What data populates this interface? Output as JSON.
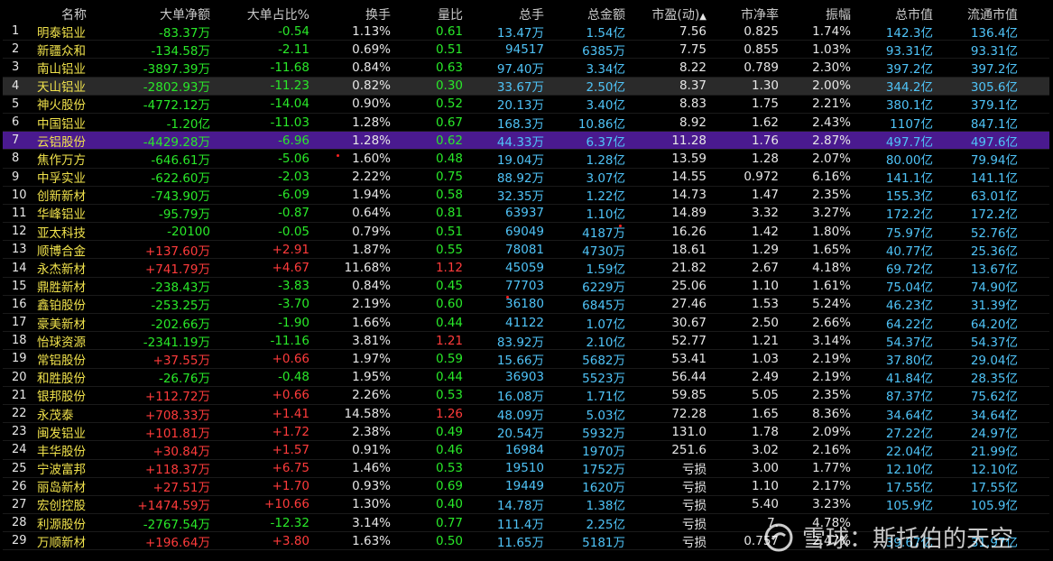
{
  "headers": [
    "名称",
    "大单净额",
    "大单占比%",
    "换手",
    "量比",
    "总手",
    "总金额",
    "市盈(动)",
    "市净率",
    "振幅",
    "总市值",
    "流通市值"
  ],
  "sort_icon": "up-arrow-icon",
  "rows": [
    {
      "idx": "1",
      "name": "明泰铝业",
      "net": "-83.37万",
      "net_c": "g",
      "pct": "-0.54",
      "pct_c": "g",
      "turn": "1.13%",
      "vr": "0.61",
      "vr_c": "g",
      "vol": "13.47万",
      "amt": "1.54亿",
      "pe": "7.56",
      "pb": "0.825",
      "amp": "1.74%",
      "mcap": "142.3亿",
      "fcap": "136.4亿"
    },
    {
      "idx": "2",
      "name": "新疆众和",
      "net": "-134.58万",
      "net_c": "g",
      "pct": "-2.11",
      "pct_c": "g",
      "turn": "0.69%",
      "vr": "0.51",
      "vr_c": "g",
      "vol": "94517",
      "amt": "6385万",
      "pe": "7.75",
      "pb": "0.855",
      "amp": "1.03%",
      "mcap": "93.31亿",
      "fcap": "93.31亿"
    },
    {
      "idx": "3",
      "name": "南山铝业",
      "net": "-3897.39万",
      "net_c": "g",
      "pct": "-11.68",
      "pct_c": "g",
      "turn": "0.84%",
      "vr": "0.63",
      "vr_c": "g",
      "vol": "97.40万",
      "amt": "3.34亿",
      "pe": "8.22",
      "pb": "0.789",
      "amp": "2.30%",
      "mcap": "397.2亿",
      "fcap": "397.2亿"
    },
    {
      "idx": "4",
      "name": "天山铝业",
      "net": "-2802.93万",
      "net_c": "g",
      "pct": "-11.23",
      "pct_c": "g",
      "turn": "0.82%",
      "vr": "0.30",
      "vr_c": "g",
      "vol": "33.67万",
      "amt": "2.50亿",
      "pe": "8.37",
      "pb": "1.30",
      "amp": "2.00%",
      "mcap": "344.2亿",
      "fcap": "305.6亿",
      "hl": "hl-dark"
    },
    {
      "idx": "5",
      "name": "神火股份",
      "net": "-4772.12万",
      "net_c": "g",
      "pct": "-14.04",
      "pct_c": "g",
      "turn": "0.90%",
      "vr": "0.52",
      "vr_c": "g",
      "vol": "20.13万",
      "amt": "3.40亿",
      "pe": "8.83",
      "pb": "1.75",
      "amp": "2.21%",
      "mcap": "380.1亿",
      "fcap": "379.1亿"
    },
    {
      "idx": "6",
      "name": "中国铝业",
      "net": "-1.20亿",
      "net_c": "g",
      "pct": "-11.03",
      "pct_c": "g",
      "turn": "1.28%",
      "vr": "0.67",
      "vr_c": "g",
      "vol": "168.3万",
      "amt": "10.86亿",
      "pe": "8.92",
      "pb": "1.62",
      "amp": "2.43%",
      "mcap": "1107亿",
      "fcap": "847.1亿"
    },
    {
      "idx": "7",
      "name": "云铝股份",
      "net": "-4429.28万",
      "net_c": "g",
      "pct": "-6.96",
      "pct_c": "g",
      "turn": "1.28%",
      "vr": "0.62",
      "vr_c": "g",
      "vol": "44.33万",
      "amt": "6.37亿",
      "pe": "11.28",
      "pb": "1.76",
      "amp": "2.87%",
      "mcap": "497.7亿",
      "fcap": "497.6亿",
      "hl": "hl-purple"
    },
    {
      "idx": "8",
      "name": "焦作万方",
      "net": "-646.61万",
      "net_c": "g",
      "pct": "-5.06",
      "pct_c": "g",
      "turn": "1.60%",
      "vr": "0.48",
      "vr_c": "g",
      "vol": "19.04万",
      "amt": "1.28亿",
      "pe": "13.59",
      "pb": "1.28",
      "amp": "2.07%",
      "mcap": "80.00亿",
      "fcap": "79.94亿"
    },
    {
      "idx": "9",
      "name": "中孚实业",
      "net": "-622.60万",
      "net_c": "g",
      "pct": "-2.03",
      "pct_c": "g",
      "turn": "2.22%",
      "vr": "0.75",
      "vr_c": "g",
      "vol": "88.92万",
      "amt": "3.07亿",
      "pe": "14.55",
      "pb": "0.972",
      "amp": "6.16%",
      "mcap": "141.1亿",
      "fcap": "141.1亿"
    },
    {
      "idx": "10",
      "name": "创新新材",
      "net": "-743.90万",
      "net_c": "g",
      "pct": "-6.09",
      "pct_c": "g",
      "turn": "1.94%",
      "vr": "0.58",
      "vr_c": "g",
      "vol": "32.35万",
      "amt": "1.22亿",
      "pe": "14.73",
      "pb": "1.47",
      "amp": "2.35%",
      "mcap": "155.3亿",
      "fcap": "63.01亿"
    },
    {
      "idx": "11",
      "name": "华峰铝业",
      "net": "-95.79万",
      "net_c": "g",
      "pct": "-0.87",
      "pct_c": "g",
      "turn": "0.64%",
      "vr": "0.81",
      "vr_c": "g",
      "vol": "63937",
      "amt": "1.10亿",
      "pe": "14.89",
      "pb": "3.32",
      "amp": "3.27%",
      "mcap": "172.2亿",
      "fcap": "172.2亿"
    },
    {
      "idx": "12",
      "name": "亚太科技",
      "net": "-20100",
      "net_c": "g",
      "pct": "-0.05",
      "pct_c": "g",
      "turn": "0.79%",
      "vr": "0.51",
      "vr_c": "g",
      "vol": "69049",
      "amt": "4187万",
      "pe": "16.26",
      "pb": "1.42",
      "amp": "1.80%",
      "mcap": "75.97亿",
      "fcap": "52.76亿"
    },
    {
      "idx": "13",
      "name": "顺博合金",
      "net": "+137.60万",
      "net_c": "r",
      "pct": "+2.91",
      "pct_c": "r",
      "turn": "1.87%",
      "vr": "0.55",
      "vr_c": "g",
      "vol": "78081",
      "amt": "4730万",
      "pe": "18.61",
      "pb": "1.29",
      "amp": "1.65%",
      "mcap": "40.77亿",
      "fcap": "25.36亿"
    },
    {
      "idx": "14",
      "name": "永杰新材",
      "net": "+741.79万",
      "net_c": "r",
      "pct": "+4.67",
      "pct_c": "r",
      "turn": "11.68%",
      "vr": "1.12",
      "vr_c": "r",
      "vol": "45059",
      "amt": "1.59亿",
      "pe": "21.82",
      "pb": "2.67",
      "amp": "4.18%",
      "mcap": "69.72亿",
      "fcap": "13.67亿"
    },
    {
      "idx": "15",
      "name": "鼎胜新材",
      "net": "-238.43万",
      "net_c": "g",
      "pct": "-3.83",
      "pct_c": "g",
      "turn": "0.84%",
      "vr": "0.45",
      "vr_c": "g",
      "vol": "77703",
      "amt": "6229万",
      "pe": "25.06",
      "pb": "1.10",
      "amp": "1.61%",
      "mcap": "75.04亿",
      "fcap": "74.90亿"
    },
    {
      "idx": "16",
      "name": "鑫铂股份",
      "net": "-253.25万",
      "net_c": "g",
      "pct": "-3.70",
      "pct_c": "g",
      "turn": "2.19%",
      "vr": "0.60",
      "vr_c": "g",
      "vol": "36180",
      "amt": "6845万",
      "pe": "27.46",
      "pb": "1.53",
      "amp": "5.24%",
      "mcap": "46.23亿",
      "fcap": "31.39亿"
    },
    {
      "idx": "17",
      "name": "豪美新材",
      "net": "-202.66万",
      "net_c": "g",
      "pct": "-1.90",
      "pct_c": "g",
      "turn": "1.66%",
      "vr": "0.44",
      "vr_c": "g",
      "vol": "41122",
      "amt": "1.07亿",
      "pe": "30.67",
      "pb": "2.50",
      "amp": "2.66%",
      "mcap": "64.22亿",
      "fcap": "64.20亿"
    },
    {
      "idx": "18",
      "name": "怡球资源",
      "net": "-2341.19万",
      "net_c": "g",
      "pct": "-11.16",
      "pct_c": "g",
      "turn": "3.81%",
      "vr": "1.21",
      "vr_c": "r",
      "vol": "83.92万",
      "amt": "2.10亿",
      "pe": "52.77",
      "pb": "1.21",
      "amp": "3.14%",
      "mcap": "54.37亿",
      "fcap": "54.37亿"
    },
    {
      "idx": "19",
      "name": "常铝股份",
      "net": "+37.55万",
      "net_c": "r",
      "pct": "+0.66",
      "pct_c": "r",
      "turn": "1.97%",
      "vr": "0.59",
      "vr_c": "g",
      "vol": "15.66万",
      "amt": "5682万",
      "pe": "53.41",
      "pb": "1.03",
      "amp": "2.19%",
      "mcap": "37.80亿",
      "fcap": "29.04亿"
    },
    {
      "idx": "20",
      "name": "和胜股份",
      "net": "-26.76万",
      "net_c": "g",
      "pct": "-0.48",
      "pct_c": "g",
      "turn": "1.95%",
      "vr": "0.44",
      "vr_c": "g",
      "vol": "36903",
      "amt": "5523万",
      "pe": "56.44",
      "pb": "2.49",
      "amp": "2.19%",
      "mcap": "41.84亿",
      "fcap": "28.35亿"
    },
    {
      "idx": "21",
      "name": "银邦股份",
      "net": "+112.72万",
      "net_c": "r",
      "pct": "+0.66",
      "pct_c": "r",
      "turn": "2.26%",
      "vr": "0.53",
      "vr_c": "g",
      "vol": "16.08万",
      "amt": "1.71亿",
      "pe": "59.85",
      "pb": "5.05",
      "amp": "2.35%",
      "mcap": "87.37亿",
      "fcap": "75.62亿"
    },
    {
      "idx": "22",
      "name": "永茂泰",
      "net": "+708.33万",
      "net_c": "r",
      "pct": "+1.41",
      "pct_c": "r",
      "turn": "14.58%",
      "vr": "1.26",
      "vr_c": "r",
      "vol": "48.09万",
      "amt": "5.03亿",
      "pe": "72.28",
      "pb": "1.65",
      "amp": "8.36%",
      "mcap": "34.64亿",
      "fcap": "34.64亿"
    },
    {
      "idx": "23",
      "name": "闽发铝业",
      "net": "+101.81万",
      "net_c": "r",
      "pct": "+1.72",
      "pct_c": "r",
      "turn": "2.38%",
      "vr": "0.49",
      "vr_c": "g",
      "vol": "20.54万",
      "amt": "5932万",
      "pe": "131.0",
      "pb": "1.78",
      "amp": "2.09%",
      "mcap": "27.22亿",
      "fcap": "24.97亿"
    },
    {
      "idx": "24",
      "name": "丰华股份",
      "net": "+30.84万",
      "net_c": "r",
      "pct": "+1.57",
      "pct_c": "r",
      "turn": "0.91%",
      "vr": "0.46",
      "vr_c": "g",
      "vol": "16984",
      "amt": "1970万",
      "pe": "251.6",
      "pb": "3.02",
      "amp": "2.16%",
      "mcap": "22.04亿",
      "fcap": "21.99亿"
    },
    {
      "idx": "25",
      "name": "宁波富邦",
      "net": "+118.37万",
      "net_c": "r",
      "pct": "+6.75",
      "pct_c": "r",
      "turn": "1.46%",
      "vr": "0.53",
      "vr_c": "g",
      "vol": "19510",
      "amt": "1752万",
      "pe": "亏损",
      "pb": "3.00",
      "amp": "1.77%",
      "mcap": "12.10亿",
      "fcap": "12.10亿"
    },
    {
      "idx": "26",
      "name": "丽岛新材",
      "net": "+27.51万",
      "net_c": "r",
      "pct": "+1.70",
      "pct_c": "r",
      "turn": "0.93%",
      "vr": "0.69",
      "vr_c": "g",
      "vol": "19449",
      "amt": "1620万",
      "pe": "亏损",
      "pb": "1.10",
      "amp": "2.17%",
      "mcap": "17.55亿",
      "fcap": "17.55亿"
    },
    {
      "idx": "27",
      "name": "宏创控股",
      "net": "+1474.59万",
      "net_c": "r",
      "pct": "+10.66",
      "pct_c": "r",
      "turn": "1.30%",
      "vr": "0.40",
      "vr_c": "g",
      "vol": "14.78万",
      "amt": "1.38亿",
      "pe": "亏损",
      "pb": "5.40",
      "amp": "3.23%",
      "mcap": "105.9亿",
      "fcap": "105.9亿"
    },
    {
      "idx": "28",
      "name": "利源股份",
      "net": "-2767.54万",
      "net_c": "g",
      "pct": "-12.32",
      "pct_c": "g",
      "turn": "3.14%",
      "vr": "0.77",
      "vr_c": "g",
      "vol": "111.4万",
      "amt": "2.25亿",
      "pe": "亏损",
      "pb": "7.",
      "amp": "4.78%",
      "mcap": "",
      "fcap": ""
    },
    {
      "idx": "29",
      "name": "万顺新材",
      "net": "+196.64万",
      "net_c": "r",
      "pct": "+3.80",
      "pct_c": "r",
      "turn": "1.63%",
      "vr": "0.50",
      "vr_c": "g",
      "vol": "11.65万",
      "amt": "5181万",
      "pe": "亏损",
      "pb": "0.757",
      "amp": "2.47%",
      "mcap": "39.67亿",
      "fcap": "31.97亿"
    }
  ],
  "watermark": "雪球：斯托伯的天空"
}
